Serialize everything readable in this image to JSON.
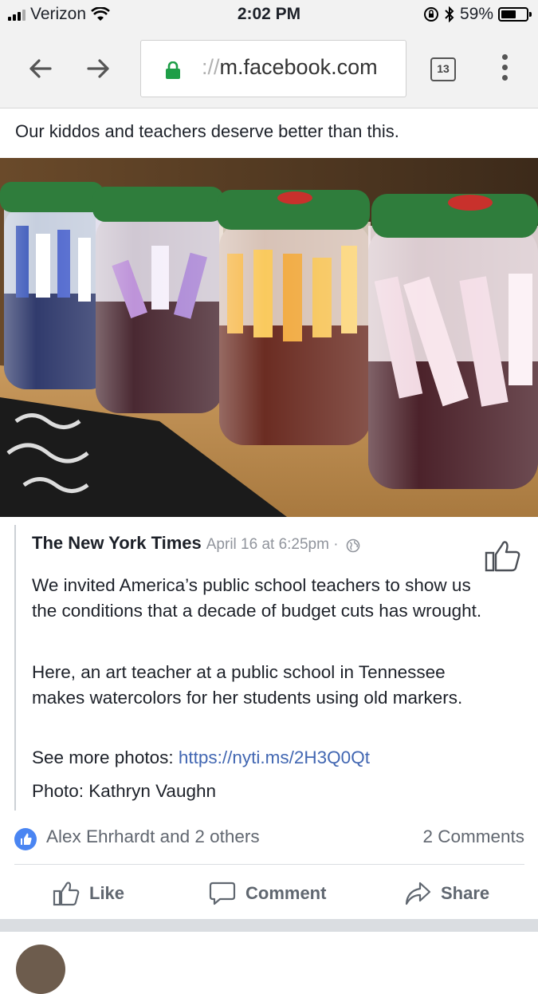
{
  "status_bar": {
    "carrier": "Verizon",
    "time": "2:02 PM",
    "battery_percent": "59%",
    "battery_level": 0.59,
    "icons": [
      "signal-icon",
      "wifi-icon",
      "rotation-lock-icon",
      "bluetooth-icon",
      "battery-icon"
    ]
  },
  "browser": {
    "url_scheme": "://",
    "url_host": "m.facebook.com",
    "tab_count": "13",
    "icons": [
      "back-arrow-icon",
      "forward-arrow-icon",
      "lock-icon",
      "more-vert-icon"
    ]
  },
  "post": {
    "text": "Our kiddos and teachers deserve better than this.",
    "shared": {
      "source": "The New York Times",
      "date": "April 16 at 6:25pm · ",
      "paragraph1": "We invited America’s public school teachers to show us the conditions that a decade of budget cuts has wrought.",
      "paragraph2": "Here, an art teacher at a public school in Tennessee makes watercolors for her students using old markers.",
      "see_more_label": "See more photos: ",
      "see_more_link": "https://nyti.ms/2H3Q0Qt",
      "photo_credit": "Photo: Kathryn Vaughn"
    },
    "reactions_text": "Alex Ehrhardt and 2 others",
    "comments_count": "2 Comments",
    "actions": {
      "like": "Like",
      "comment": "Comment",
      "share": "Share"
    }
  },
  "colors": {
    "link": "#4267b2",
    "like_badge": "#4a85f2",
    "lock_green": "#1e9e47"
  }
}
